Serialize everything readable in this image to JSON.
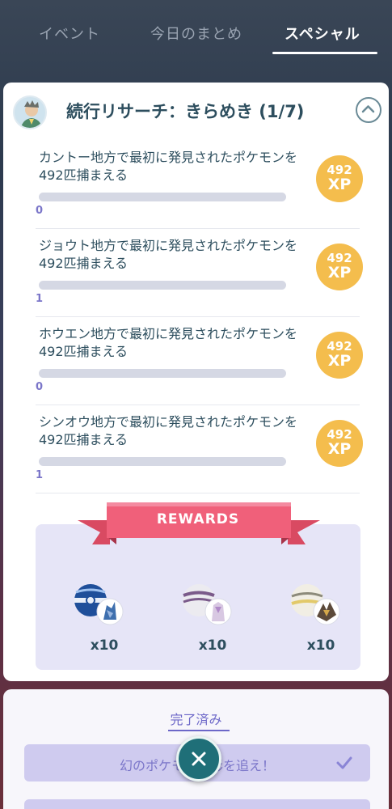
{
  "tabs": [
    {
      "label": "イベント"
    },
    {
      "label": "今日のまとめ"
    },
    {
      "label": "スペシャル"
    }
  ],
  "research": {
    "title": "続行リサーチ：きらめき (1/7)",
    "tasks": [
      {
        "text": "カントー地方で最初に発見されたポケモンを492匹捕まえる",
        "progress": "0",
        "progress_fraction": 0,
        "xp_value": "492",
        "xp_unit": "XP"
      },
      {
        "text": "ジョウト地方で最初に発見されたポケモンを492匹捕まえる",
        "progress": "1",
        "progress_fraction": 0.002,
        "xp_value": "492",
        "xp_unit": "XP"
      },
      {
        "text": "ホウエン地方で最初に発見されたポケモンを492匹捕まえる",
        "progress": "0",
        "progress_fraction": 0,
        "xp_value": "492",
        "xp_unit": "XP"
      },
      {
        "text": "シンオウ地方で最初に発見されたポケモンを492匹捕まえる",
        "progress": "1",
        "progress_fraction": 0.002,
        "xp_value": "492",
        "xp_unit": "XP"
      }
    ],
    "rewards_label": "REWARDS",
    "rewards": [
      {
        "qty": "x10",
        "icon": "dialga-encounter-icon"
      },
      {
        "qty": "x10",
        "icon": "palkia-encounter-icon"
      },
      {
        "qty": "x10",
        "icon": "giratina-encounter-icon"
      }
    ]
  },
  "completed": {
    "tab_label": "完了済み",
    "quest_label": "幻のポケモンの影を追え！"
  },
  "colors": {
    "xp_badge": "#f4bd4d",
    "ribbon": "#f0607a",
    "accent": "#6c67c8",
    "title_text": "#2d4e5e"
  }
}
